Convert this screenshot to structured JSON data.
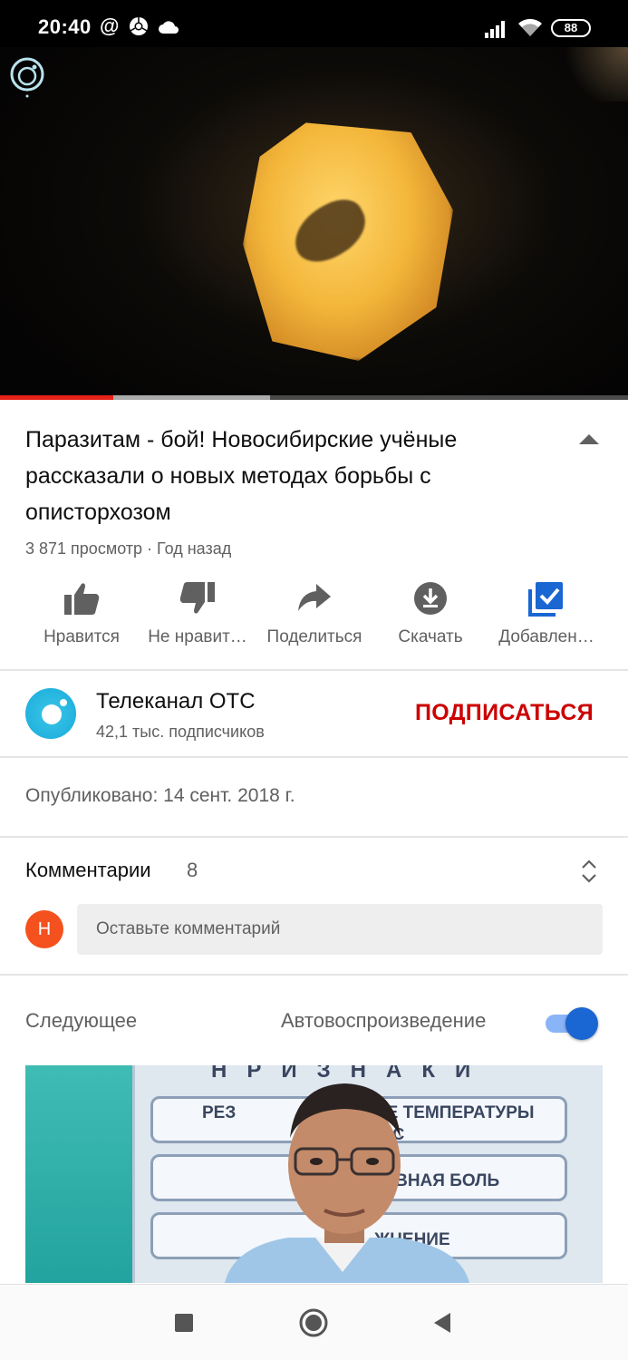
{
  "status_bar": {
    "time": "20:40",
    "at_symbol": "@",
    "battery": "88",
    "icons": [
      "at-icon",
      "chrome-icon",
      "cloud-icon",
      "signal-icon",
      "wifi-icon",
      "battery-icon"
    ]
  },
  "video": {
    "overlay_logo": "ОТС",
    "progress_played": 0.18,
    "progress_buffered": 0.43
  },
  "title": "Паразитам - бой! Новосибирские учёные рассказали о новых методах борьбы с описторхозом",
  "meta": "3 871 просмотр · Год назад",
  "actions": [
    {
      "icon": "thumb-up-icon",
      "label": "Нравится"
    },
    {
      "icon": "thumb-down-icon",
      "label": "Не нравит…"
    },
    {
      "icon": "share-icon",
      "label": "Поделиться"
    },
    {
      "icon": "download-icon",
      "label": "Скачать"
    },
    {
      "icon": "added-playlist-icon",
      "label": "Добавлен…"
    }
  ],
  "channel": {
    "name": "Телеканал ОТС",
    "subscribers": "42,1 тыс. подписчиков",
    "subscribe_label": "ПОДПИСАТЬСЯ"
  },
  "published": "Опубликовано: 14 сент. 2018 г.",
  "comments": {
    "label": "Комментарии",
    "count": "8",
    "user_initial": "Н",
    "placeholder": "Оставьте комментарий"
  },
  "up_next": {
    "label": "Следующее",
    "autoplay_label": "Автовоспроизведение",
    "autoplay_on": true,
    "thumbnail_text": [
      "Н",
      "Р",
      "И",
      "З",
      "Н",
      "А",
      "К",
      "И",
      "РЕЗ",
      "ИЕ ТЕМПЕРАТУРЫ",
      "39°С",
      "ЛОВНАЯ БОЛЬ",
      "ЖНЕНИЕ"
    ]
  },
  "nav": {
    "icons": [
      "recents-icon",
      "home-icon",
      "back-icon"
    ]
  },
  "colors": {
    "accent_red": "#cc0000",
    "progress_red": "#e62117",
    "toggle_blue": "#1a66d2",
    "avatar_orange": "#f4511e",
    "playlist_blue": "#1a66d2"
  }
}
